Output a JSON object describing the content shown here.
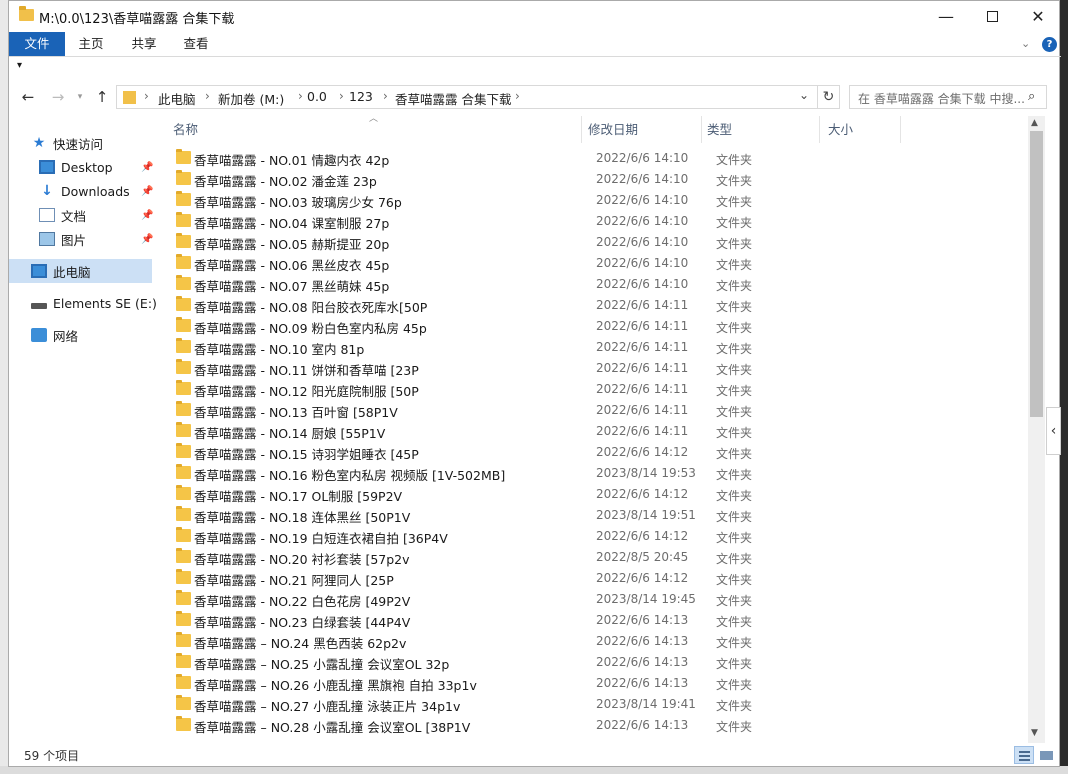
{
  "window": {
    "title": "M:\\0.0\\123\\香草喵露露 合集下载",
    "minimize": "—",
    "close": "✕"
  },
  "ribbon": {
    "file": "文件",
    "tabs": [
      "主页",
      "共享",
      "查看"
    ],
    "expand": "⌄",
    "help": "?"
  },
  "address": {
    "crumbs": [
      "此电脑",
      "新加卷 (M:)",
      "0.0",
      "123",
      "香草喵露露 合集下载"
    ],
    "refresh": "↻",
    "dropdown": "⌄"
  },
  "search": {
    "placeholder": "在 香草喵露露 合集下载 中搜..."
  },
  "nav": {
    "quick_access": "快速访问",
    "desktop": "Desktop",
    "downloads": "Downloads",
    "documents": "文档",
    "pictures": "图片",
    "this_pc": "此电脑",
    "drive": "Elements SE (E:)",
    "network": "网络"
  },
  "columns": {
    "name": "名称",
    "date": "修改日期",
    "type": "类型",
    "size": "大小"
  },
  "files": [
    {
      "name": "香草喵露露 - NO.01 情趣内衣 42p",
      "date": "2022/6/6 14:10",
      "type": "文件夹"
    },
    {
      "name": "香草喵露露 - NO.02 潘金莲 23p",
      "date": "2022/6/6 14:10",
      "type": "文件夹"
    },
    {
      "name": "香草喵露露 - NO.03 玻璃房少女 76p",
      "date": "2022/6/6 14:10",
      "type": "文件夹"
    },
    {
      "name": "香草喵露露 - NO.04 课室制服 27p",
      "date": "2022/6/6 14:10",
      "type": "文件夹"
    },
    {
      "name": "香草喵露露 - NO.05 赫斯提亚 20p",
      "date": "2022/6/6 14:10",
      "type": "文件夹"
    },
    {
      "name": "香草喵露露 - NO.06 黑丝皮衣 45p",
      "date": "2022/6/6 14:10",
      "type": "文件夹"
    },
    {
      "name": "香草喵露露 - NO.07 黑丝萌妹 45p",
      "date": "2022/6/6 14:10",
      "type": "文件夹"
    },
    {
      "name": "香草喵露露 - NO.08 阳台胶衣死库水[50P",
      "date": "2022/6/6 14:11",
      "type": "文件夹"
    },
    {
      "name": "香草喵露露 - NO.09 粉白色室内私房 45p",
      "date": "2022/6/6 14:11",
      "type": "文件夹"
    },
    {
      "name": "香草喵露露 - NO.10 室内 81p",
      "date": "2022/6/6 14:11",
      "type": "文件夹"
    },
    {
      "name": "香草喵露露 - NO.11 饼饼和香草喵 [23P",
      "date": "2022/6/6 14:11",
      "type": "文件夹"
    },
    {
      "name": "香草喵露露 - NO.12 阳光庭院制服 [50P",
      "date": "2022/6/6 14:11",
      "type": "文件夹"
    },
    {
      "name": "香草喵露露 - NO.13 百叶窗 [58P1V",
      "date": "2022/6/6 14:11",
      "type": "文件夹"
    },
    {
      "name": "香草喵露露 - NO.14 厨娘 [55P1V",
      "date": "2022/6/6 14:11",
      "type": "文件夹"
    },
    {
      "name": "香草喵露露 - NO.15 诗羽学姐睡衣 [45P",
      "date": "2022/6/6 14:12",
      "type": "文件夹"
    },
    {
      "name": "香草喵露露 - NO.16 粉色室内私房 视频版 [1V-502MB]",
      "date": "2023/8/14 19:53",
      "type": "文件夹"
    },
    {
      "name": "香草喵露露 - NO.17 OL制服 [59P2V",
      "date": "2022/6/6 14:12",
      "type": "文件夹"
    },
    {
      "name": "香草喵露露 - NO.18 连体黑丝 [50P1V",
      "date": "2023/8/14 19:51",
      "type": "文件夹"
    },
    {
      "name": "香草喵露露 - NO.19 白短连衣裙自拍 [36P4V",
      "date": "2022/6/6 14:12",
      "type": "文件夹"
    },
    {
      "name": "香草喵露露 - NO.20 衬衫套装 [57p2v",
      "date": "2022/8/5 20:45",
      "type": "文件夹"
    },
    {
      "name": "香草喵露露 - NO.21 阿狸同人 [25P",
      "date": "2022/6/6 14:12",
      "type": "文件夹"
    },
    {
      "name": "香草喵露露 - NO.22 白色花房 [49P2V",
      "date": "2023/8/14 19:45",
      "type": "文件夹"
    },
    {
      "name": "香草喵露露 - NO.23 白绿套装 [44P4V",
      "date": "2022/6/6 14:13",
      "type": "文件夹"
    },
    {
      "name": "香草喵露露 – NO.24 黑色西装 62p2v",
      "date": "2022/6/6 14:13",
      "type": "文件夹"
    },
    {
      "name": "香草喵露露 – NO.25 小露乱撞 会议室OL 32p",
      "date": "2022/6/6 14:13",
      "type": "文件夹"
    },
    {
      "name": "香草喵露露 – NO.26 小鹿乱撞 黑旗袍 自拍 33p1v",
      "date": "2022/6/6 14:13",
      "type": "文件夹"
    },
    {
      "name": "香草喵露露 – NO.27 小鹿乱撞 泳装正片 34p1v",
      "date": "2023/8/14 19:41",
      "type": "文件夹"
    },
    {
      "name": "香草喵露露 – NO.28 小露乱撞 会议室OL [38P1V",
      "date": "2022/6/6 14:13",
      "type": "文件夹"
    }
  ],
  "status": {
    "count": "59 个项目"
  }
}
